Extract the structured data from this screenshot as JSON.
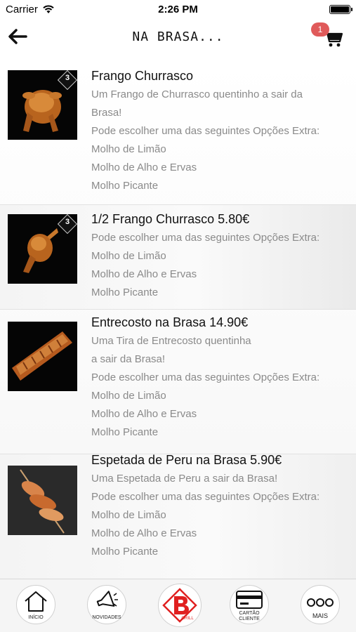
{
  "status_bar": {
    "carrier": "Carrier",
    "time": "2:26 PM"
  },
  "nav": {
    "title": "NA BRASA...",
    "cart_count": "1",
    "icons": [
      "back-arrow-icon",
      "cart-icon"
    ]
  },
  "items": [
    {
      "title": "Frango Churrasco",
      "lines": [
        "Um Frango de Churrasco quentinho a sair da",
        "Brasa!",
        "Pode escolher uma das seguintes Opções Extra:",
        "Molho de Limão",
        "Molho de Alho e Ervas",
        "Molho Picante"
      ],
      "badge": "3"
    },
    {
      "title": "1/2 Frango Churrasco 5.80€",
      "lines": [
        "Pode escolher uma das seguintes Opções Extra:",
        "Molho de Limão",
        "Molho de Alho e Ervas",
        "Molho Picante"
      ],
      "badge": "3"
    },
    {
      "title": "Entrecosto na Brasa 14.90€",
      "lines": [
        "Uma Tira de Entrecosto quentinha",
        "a sair da Brasa!",
        "Pode escolher uma das seguintes Opções Extra:",
        "Molho de Limão",
        "Molho de Alho e Ervas",
        "Molho Picante"
      ]
    },
    {
      "title": "Espetada de Peru na Brasa 5.90€",
      "lines": [
        "Uma Espetada de Peru a sair da Brasa!",
        "Pode escolher uma das seguintes Opções Extra:",
        "Molho de Limão",
        "Molho de Alho e Ervas",
        "Molho Picante"
      ]
    }
  ],
  "tabs": [
    {
      "label": "INÍCIO",
      "icon": "home-icon"
    },
    {
      "label": "NOVIDADES",
      "icon": "megaphone-icon"
    },
    {
      "label": "GRILL",
      "icon": "brand-logo-icon"
    },
    {
      "label": "CARTÃO\nCLIENTE",
      "label_1": "CARTÃO",
      "label_2": "CLIENTE",
      "icon": "card-icon"
    },
    {
      "label": "MAIS",
      "icon": "more-icon"
    }
  ],
  "colors": {
    "badge": "#e05a5a",
    "brand_red": "#e02020",
    "text_secondary": "#8a8a8a"
  }
}
